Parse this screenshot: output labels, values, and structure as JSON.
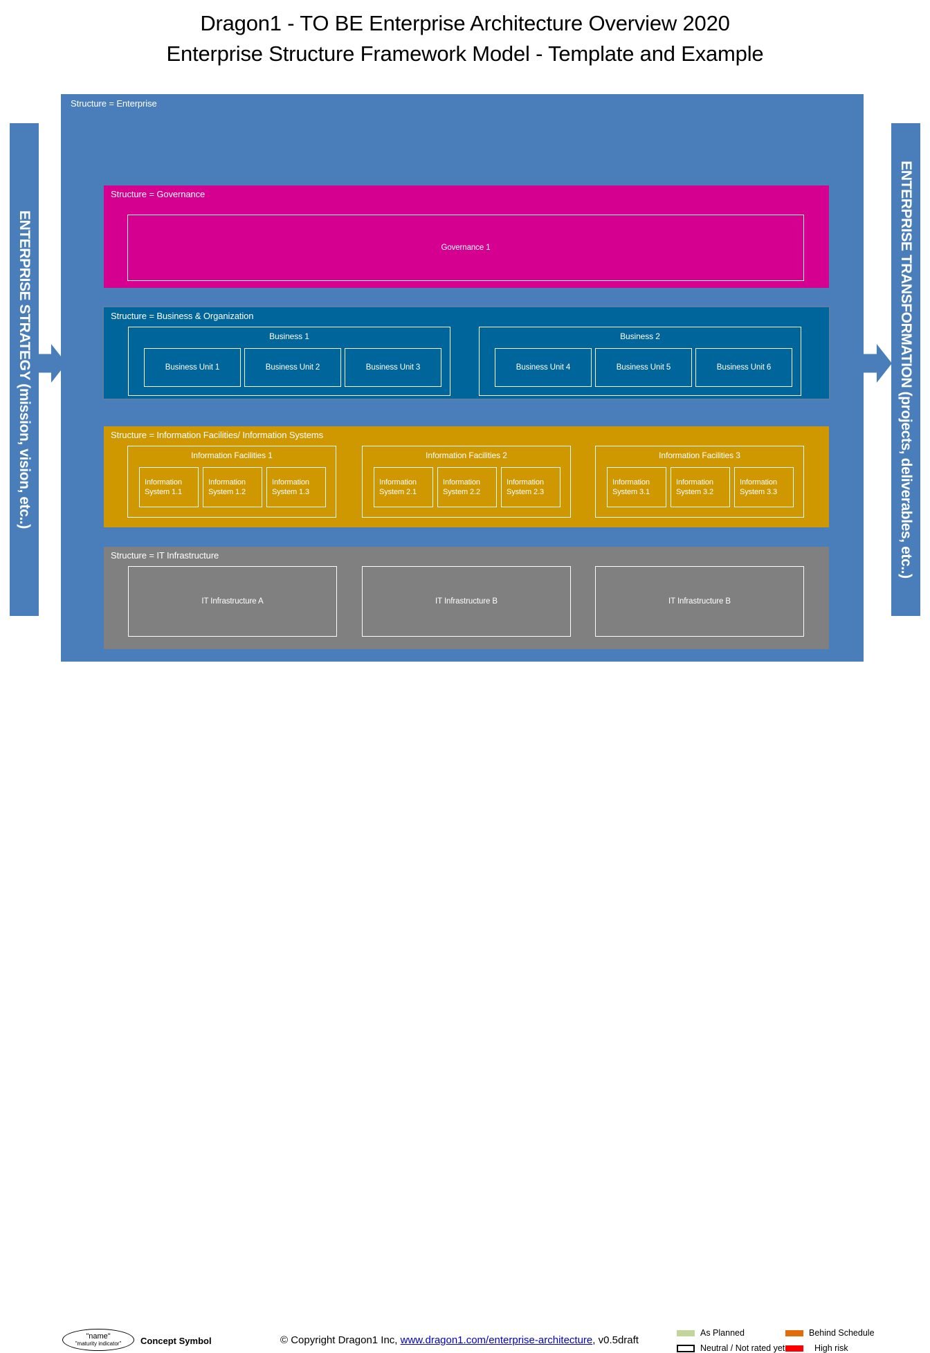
{
  "title": {
    "line1": "Dragon1 - TO BE Enterprise Architecture Overview 2020",
    "line2": "Enterprise Structure Framework Model - Template and Example"
  },
  "side_bars": {
    "left": {
      "label": "ENTERPRISE STRATEGY (mission, vision, etc..)",
      "color": "#4a7ebb",
      "arrow": "arrow-right-icon"
    },
    "right": {
      "label": "ENTERPRISE TRANSFORMATION (projects, deliverables, etc..)",
      "color": "#4a7ebb",
      "arrow": "arrow-right-icon"
    }
  },
  "enterprise": {
    "label": "Structure = Enterprise",
    "color": "#4a7ebb"
  },
  "layers": {
    "governance": {
      "label": "Structure = Governance",
      "color": "#d5008f",
      "items": [
        {
          "name": "Governance 1"
        }
      ]
    },
    "business": {
      "label": "Structure = Business & Organization",
      "color": "#00659a",
      "groups": [
        {
          "title": "Business 1",
          "units": [
            "Business Unit 1",
            "Business Unit 2",
            "Business Unit 3"
          ]
        },
        {
          "title": "Business 2",
          "units": [
            "Business Unit 4",
            "Business Unit 5",
            "Business Unit 6"
          ]
        }
      ]
    },
    "information": {
      "label": "Structure = Information Facilities/ Information Systems",
      "color": "#cf9800",
      "groups": [
        {
          "title": "Information Facilities 1",
          "systems": [
            "Information System 1.1",
            "Information System 1.2",
            "Information System 1.3"
          ]
        },
        {
          "title": "Information Facilities 2",
          "systems": [
            "Information System 2.1",
            "Information System 2.2",
            "Information System 2.3"
          ]
        },
        {
          "title": "Information Facilities 3",
          "systems": [
            "Information System 3.1",
            "Information System 3.2",
            "Information System 3.3"
          ]
        }
      ]
    },
    "infrastructure": {
      "label": "Structure = IT Infrastructure",
      "color": "#808080",
      "items": [
        "IT Infrastructure A",
        "IT Infrastructure B",
        "IT Infrastructure B"
      ]
    }
  },
  "footer": {
    "concept_symbol": {
      "name": "\"name\"",
      "maturity": "\"maturity indicator\"",
      "caption": "Concept Symbol"
    },
    "copyright": {
      "prefix": "© Copyright Dragon1 Inc, ",
      "link": "www.dragon1.com/enterprise-architecture",
      "suffix": ", v0.5draft"
    },
    "legend": [
      {
        "label": "As Planned",
        "color": "#c2d69b"
      },
      {
        "label": "Behind Schedule",
        "color": "#e36c0a"
      },
      {
        "label": "Neutral / Not rated yet",
        "color": "#ffffff"
      },
      {
        "label": "High risk",
        "color": "#ff0000"
      }
    ]
  }
}
